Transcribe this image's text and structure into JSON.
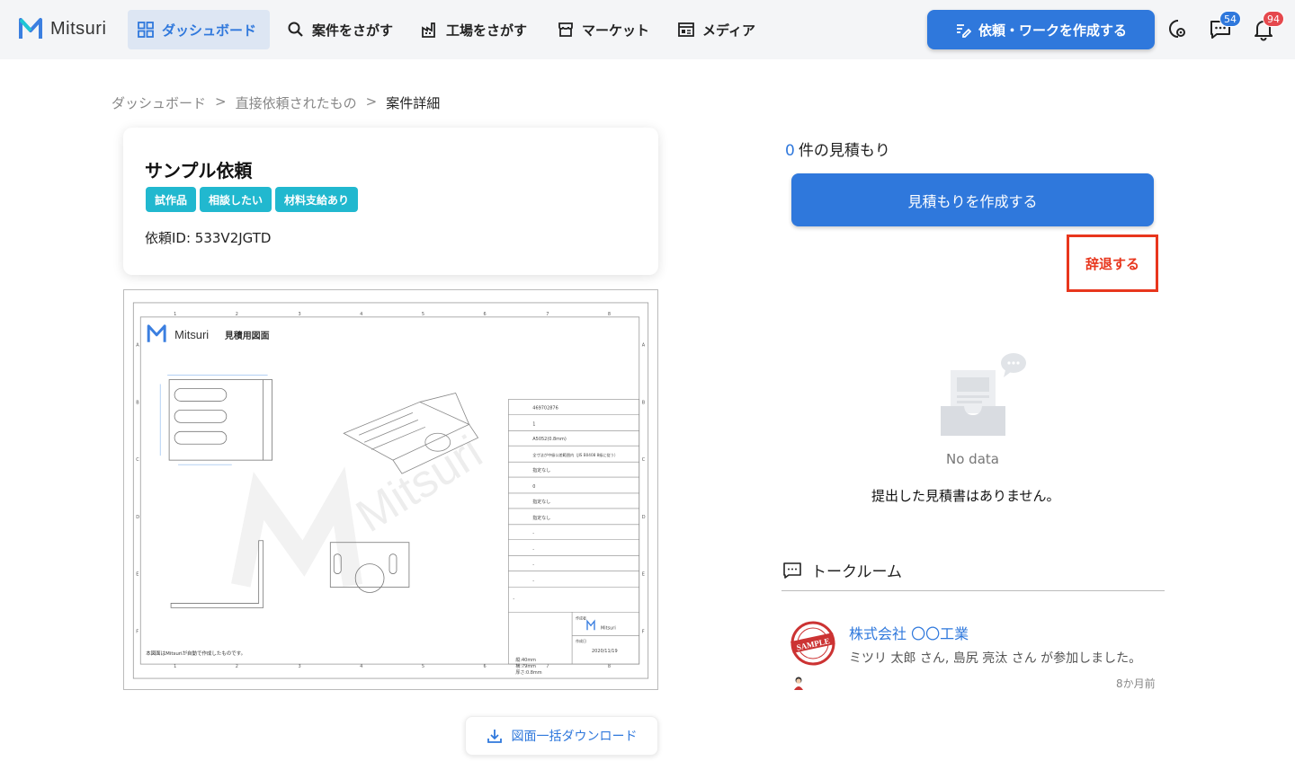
{
  "header": {
    "logo_text": "Mitsuri",
    "nav": [
      {
        "label": "ダッシュボード",
        "icon": "grid-icon",
        "active": true
      },
      {
        "label": "案件をさがす",
        "icon": "search-icon",
        "active": false
      },
      {
        "label": "工場をさがす",
        "icon": "factory-icon",
        "active": false
      },
      {
        "label": "マーケット",
        "icon": "store-icon",
        "active": false
      },
      {
        "label": "メディア",
        "icon": "newspaper-icon",
        "active": false
      }
    ],
    "create_button": "依頼・ワークを作成する",
    "message_badge": "54",
    "notification_badge": "94"
  },
  "breadcrumb": {
    "items": [
      "ダッシュボード",
      "直接依頼されたもの",
      "案件詳細"
    ],
    "separator": ">"
  },
  "request": {
    "title": "サンプル依頼",
    "tags": [
      "試作品",
      "相談したい",
      "材料支給あり"
    ],
    "id_label": "依頼ID: 533V2JGTD"
  },
  "drawing": {
    "header_brand": "Mitsuri",
    "header_title": "見積用図面",
    "footer_note": "本図面はMitsuriが自動で作成したものです。",
    "watermark": "Mitsuri",
    "col_numbers": [
      "1",
      "2",
      "3",
      "4",
      "5",
      "6",
      "7",
      "8"
    ],
    "row_letters": [
      "A",
      "B",
      "C",
      "D",
      "E",
      "F"
    ],
    "table_values": [
      "469702876",
      "1",
      "A5052(0.8mm)",
      "全寸法が中級公差範囲内（JIS B0408 8級に従う）",
      "指定なし",
      "0",
      "指定なし",
      "指定なし",
      "-",
      "-",
      "-",
      "-",
      "-"
    ],
    "creator_label": "作成者",
    "creator_value": "Mitsuri",
    "date_label": "作成日",
    "date_value": "2020/11/19",
    "size_lines": [
      "縦:40mm",
      "横:79mm",
      "厚さ:0.8mm"
    ]
  },
  "download_button": "図面一括ダウンロード",
  "quotes": {
    "count": "0",
    "count_suffix": "件の見積もり",
    "create_button": "見積もりを作成する",
    "decline_button": "辞退する",
    "empty_title": "No data",
    "empty_message": "提出した見積書はありません。"
  },
  "talkroom": {
    "title": "トークルーム",
    "rooms": [
      {
        "name": "株式会社 〇〇工業",
        "message": "ミツリ 太郎 さん, 島尻 亮汰 さん が参加しました。",
        "time": "8か月前",
        "avatar_text": "SAMPLE"
      }
    ]
  },
  "colors": {
    "primary": "#2f78dc",
    "tag": "#21b8cf",
    "decline": "#e8361d",
    "badge_red": "#e5484d"
  }
}
